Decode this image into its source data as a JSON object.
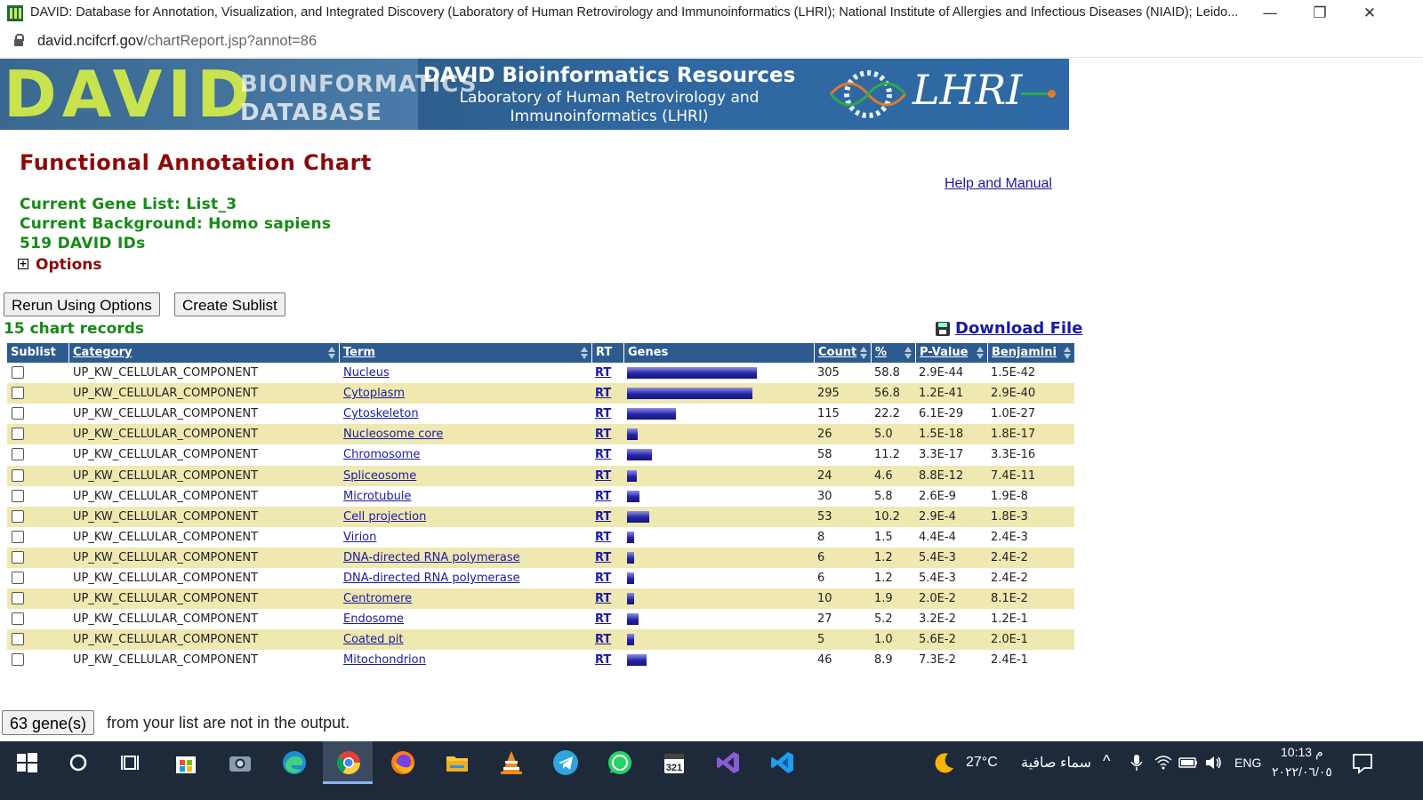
{
  "window": {
    "title": "DAVID: Database for Annotation, Visualization, and Integrated Discovery (Laboratory of Human Retrovirology and Immunoinformatics (LHRI); National Institute of Allergies and Infectious Diseases (NIAID); Leido...",
    "minimize": "—",
    "restore": "❐",
    "close": "✕"
  },
  "address": {
    "host": "david.ncifcrf.gov",
    "path": "/chartReport.jsp?annot=86"
  },
  "banner": {
    "logo_big": "DAVID",
    "logo_line1": "BIOINFORMATICS",
    "logo_line2": "DATABASE",
    "heading": "DAVID Bioinformatics Resources",
    "sub1": "Laboratory of Human Retrovirology and",
    "sub2": "Immunoinformatics (LHRI)",
    "lhri": "LHRI"
  },
  "page": {
    "title": "Functional Annotation Chart",
    "help_link": "Help and Manual",
    "gene_list": "Current Gene List: List_3",
    "background": "Current Background: Homo sapiens",
    "ids": "519 DAVID IDs",
    "options_box": "+",
    "options": "Options",
    "rerun_button": "Rerun Using Options",
    "sublist_button": "Create Sublist",
    "records": "15 chart records",
    "download": "Download File",
    "missing_button": "63 gene(s)",
    "missing_text": "from your list are not in the output."
  },
  "table": {
    "headers": {
      "sublist": "Sublist",
      "category": "Category",
      "term": "Term",
      "rt": "RT",
      "genes": "Genes",
      "count": "Count",
      "percent": "%",
      "pvalue": "P-Value",
      "benjamini": "Benjamini"
    },
    "rows": [
      {
        "category": "UP_KW_CELLULAR_COMPONENT",
        "term": "Nucleus",
        "rt": "RT",
        "count": "305",
        "percent": "58.8",
        "pvalue": "2.9E-44",
        "benjamini": "1.5E-42"
      },
      {
        "category": "UP_KW_CELLULAR_COMPONENT",
        "term": "Cytoplasm",
        "rt": "RT",
        "count": "295",
        "percent": "56.8",
        "pvalue": "1.2E-41",
        "benjamini": "2.9E-40"
      },
      {
        "category": "UP_KW_CELLULAR_COMPONENT",
        "term": "Cytoskeleton",
        "rt": "RT",
        "count": "115",
        "percent": "22.2",
        "pvalue": "6.1E-29",
        "benjamini": "1.0E-27"
      },
      {
        "category": "UP_KW_CELLULAR_COMPONENT",
        "term": "Nucleosome core",
        "rt": "RT",
        "count": "26",
        "percent": "5.0",
        "pvalue": "1.5E-18",
        "benjamini": "1.8E-17"
      },
      {
        "category": "UP_KW_CELLULAR_COMPONENT",
        "term": "Chromosome",
        "rt": "RT",
        "count": "58",
        "percent": "11.2",
        "pvalue": "3.3E-17",
        "benjamini": "3.3E-16"
      },
      {
        "category": "UP_KW_CELLULAR_COMPONENT",
        "term": "Spliceosome",
        "rt": "RT",
        "count": "24",
        "percent": "4.6",
        "pvalue": "8.8E-12",
        "benjamini": "7.4E-11"
      },
      {
        "category": "UP_KW_CELLULAR_COMPONENT",
        "term": "Microtubule",
        "rt": "RT",
        "count": "30",
        "percent": "5.8",
        "pvalue": "2.6E-9",
        "benjamini": "1.9E-8"
      },
      {
        "category": "UP_KW_CELLULAR_COMPONENT",
        "term": "Cell projection",
        "rt": "RT",
        "count": "53",
        "percent": "10.2",
        "pvalue": "2.9E-4",
        "benjamini": "1.8E-3"
      },
      {
        "category": "UP_KW_CELLULAR_COMPONENT",
        "term": "Virion",
        "rt": "RT",
        "count": "8",
        "percent": "1.5",
        "pvalue": "4.4E-4",
        "benjamini": "2.4E-3"
      },
      {
        "category": "UP_KW_CELLULAR_COMPONENT",
        "term": "DNA-directed RNA polymerase",
        "rt": "RT",
        "count": "6",
        "percent": "1.2",
        "pvalue": "5.4E-3",
        "benjamini": "2.4E-2"
      },
      {
        "category": "UP_KW_CELLULAR_COMPONENT",
        "term": "DNA-directed RNA polymerase",
        "rt": "RT",
        "count": "6",
        "percent": "1.2",
        "pvalue": "5.4E-3",
        "benjamini": "2.4E-2"
      },
      {
        "category": "UP_KW_CELLULAR_COMPONENT",
        "term": "Centromere",
        "rt": "RT",
        "count": "10",
        "percent": "1.9",
        "pvalue": "2.0E-2",
        "benjamini": "8.1E-2"
      },
      {
        "category": "UP_KW_CELLULAR_COMPONENT",
        "term": "Endosome",
        "rt": "RT",
        "count": "27",
        "percent": "5.2",
        "pvalue": "3.2E-2",
        "benjamini": "1.2E-1"
      },
      {
        "category": "UP_KW_CELLULAR_COMPONENT",
        "term": "Coated pit",
        "rt": "RT",
        "count": "5",
        "percent": "1.0",
        "pvalue": "5.6E-2",
        "benjamini": "2.0E-1"
      },
      {
        "category": "UP_KW_CELLULAR_COMPONENT",
        "term": "Mitochondrion",
        "rt": "RT",
        "count": "46",
        "percent": "8.9",
        "pvalue": "7.3E-2",
        "benjamini": "2.4E-1"
      }
    ]
  },
  "taskbar": {
    "apps": [
      "windows-start-icon",
      "search-circle-icon",
      "task-view-icon",
      "microsoft-store-icon",
      "camera-icon",
      "edge-icon",
      "chrome-icon",
      "firefox-icon",
      "file-explorer-icon",
      "vlc-icon",
      "telegram-icon",
      "whatsapp-icon",
      "calendar-app-icon",
      "visual-studio-icon",
      "vscode-icon"
    ],
    "weather_temp": "27°C",
    "weather_text": "سماء صافية",
    "lang": "ENG",
    "time": "10:13 م",
    "date": "٢٠٢٢/٠٦/٠٥"
  },
  "colors": {
    "title_red": "#8b0a0a",
    "info_green": "#168a16",
    "header_blue": "#2d5b8f",
    "row_alt": "#efe8b0",
    "link_blue": "#1a1aa6"
  }
}
